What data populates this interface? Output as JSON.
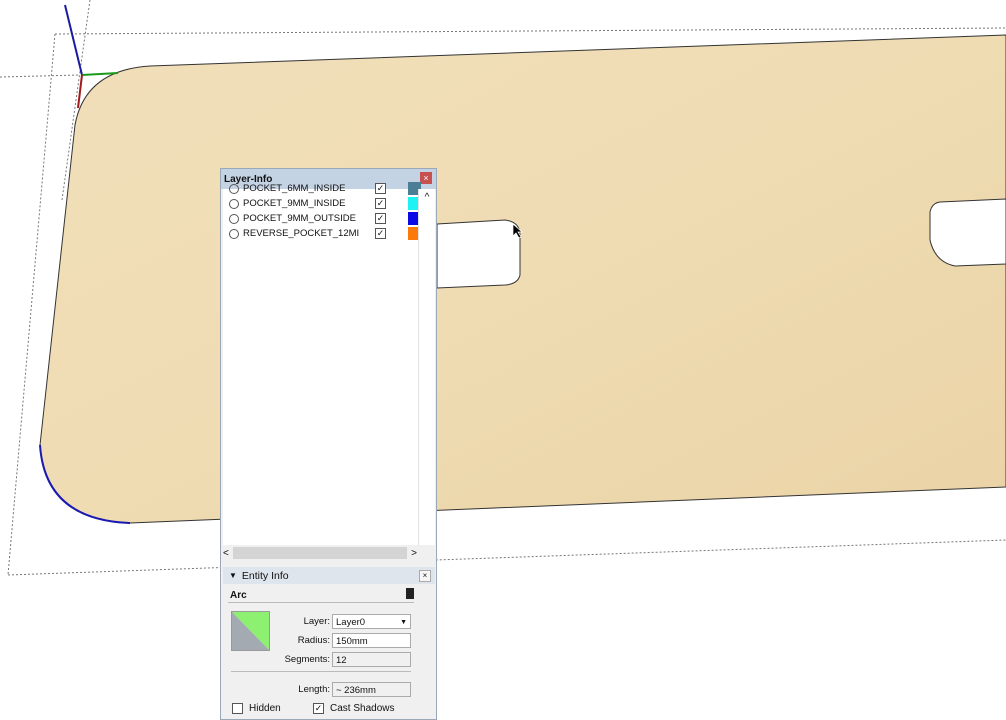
{
  "layer_info": {
    "title": "Layer-Info",
    "layers": [
      {
        "name": "POCKET_6MM_INSIDE",
        "visible": true,
        "color": "#4a7f95"
      },
      {
        "name": "POCKET_9MM_INSIDE",
        "visible": true,
        "color": "#1ef2f2"
      },
      {
        "name": "POCKET_9MM_OUTSIDE",
        "visible": true,
        "color": "#0a0ae6"
      },
      {
        "name": "REVERSE_POCKET_12MI",
        "visible": true,
        "color": "#fa7a0a"
      }
    ]
  },
  "entity_info": {
    "title": "Entity Info",
    "entity_type": "Arc",
    "layer_label": "Layer:",
    "layer_value": "Layer0",
    "radius_label": "Radius:",
    "radius_value": "150mm",
    "segments_label": "Segments:",
    "segments_value": "12",
    "length_label": "Length:",
    "length_value": "~ 236mm",
    "hidden_label": "Hidden",
    "hidden": false,
    "cast_shadows_label": "Cast Shadows",
    "cast_shadows": true
  },
  "icons": {
    "check": "✓",
    "close": "×",
    "collapse": "▼",
    "up": "^",
    "left": "<",
    "right": ">"
  }
}
